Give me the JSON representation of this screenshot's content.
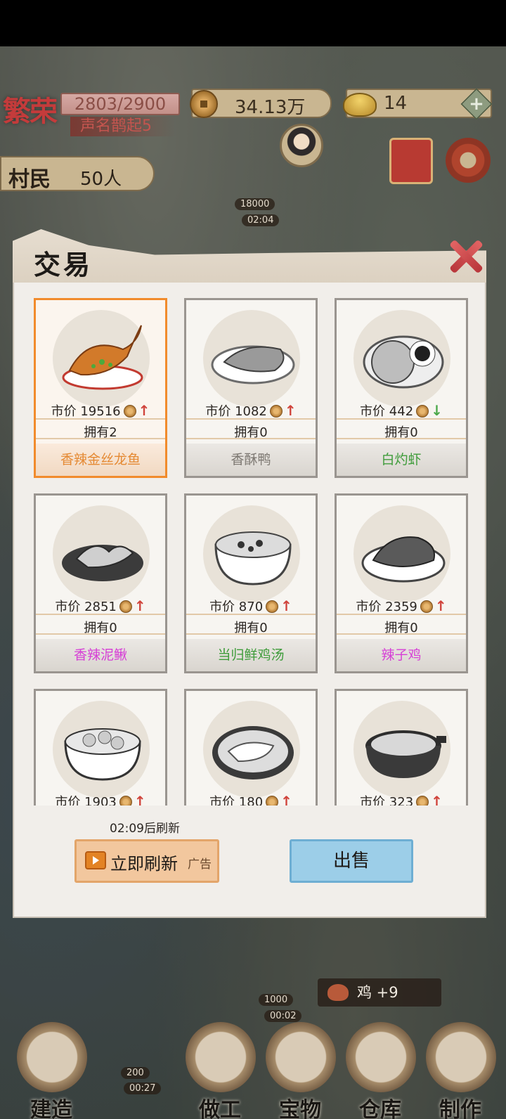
{
  "hud": {
    "prosperity_title": "繁荣",
    "prosperity_value": "2803/2900",
    "prosperity_sub": "声名鹊起5",
    "coins": "34.13万",
    "ingots": "14",
    "plus": "+",
    "villagers_label": "村民",
    "villagers_value": "50人"
  },
  "world_tags": [
    "18000",
    "02:04",
    "1000",
    "00:02",
    "200",
    "00:27"
  ],
  "dialog": {
    "title": "交易",
    "price_prefix": "市价",
    "owned_prefix": "拥有",
    "items": [
      {
        "name": "香辣金丝龙鱼",
        "price": "19516",
        "owned": "2",
        "trend": "up",
        "name_color": "#e58a34",
        "selected": true,
        "icon": "fish-dish-icon"
      },
      {
        "name": "香酥鸭",
        "price": "1082",
        "owned": "0",
        "trend": "up",
        "name_color": "#7d7872",
        "selected": false,
        "icon": "duck-dish-icon"
      },
      {
        "name": "白灼虾",
        "price": "442",
        "owned": "0",
        "trend": "down",
        "name_color": "#3f9c3b",
        "selected": false,
        "icon": "shrimp-dish-icon"
      },
      {
        "name": "香辣泥鳅",
        "price": "2851",
        "owned": "0",
        "trend": "up",
        "name_color": "#d63fd6",
        "selected": false,
        "icon": "loach-dish-icon"
      },
      {
        "name": "当归鲜鸡汤",
        "price": "870",
        "owned": "0",
        "trend": "up",
        "name_color": "#3f9c3b",
        "selected": false,
        "icon": "chicken-soup-icon"
      },
      {
        "name": "辣子鸡",
        "price": "2359",
        "owned": "0",
        "trend": "up",
        "name_color": "#d63fd6",
        "selected": false,
        "icon": "spicy-chicken-icon"
      },
      {
        "name": "",
        "price": "1903",
        "owned": "",
        "trend": "up",
        "name_color": "#7d7872",
        "selected": false,
        "icon": "dumpling-bowl-icon"
      },
      {
        "name": "",
        "price": "180",
        "owned": "",
        "trend": "up",
        "name_color": "#7d7872",
        "selected": false,
        "icon": "vegetable-bowl-icon"
      },
      {
        "name": "",
        "price": "323",
        "owned": "",
        "trend": "up",
        "name_color": "#7d7872",
        "selected": false,
        "icon": "hotpot-icon"
      }
    ],
    "refresh_timer": "02:09后刷新",
    "refresh_button": "立即刷新",
    "ad_tag": "广告",
    "sell_button": "出售"
  },
  "toast": {
    "text": "鸡 +9"
  },
  "nav": [
    {
      "label": "建造",
      "icon": "build-icon"
    },
    {
      "label": "做工",
      "icon": "work-icon"
    },
    {
      "label": "宝物",
      "icon": "treasure-icon"
    },
    {
      "label": "仓库",
      "icon": "warehouse-icon"
    },
    {
      "label": "制作",
      "icon": "craft-icon"
    }
  ],
  "colors": {
    "selected_border": "#f18b2c",
    "trend_up": "#d0433b",
    "trend_down": "#4aa84a",
    "sell_button": "#9ccee8",
    "refresh_button": "#f2c79e"
  }
}
